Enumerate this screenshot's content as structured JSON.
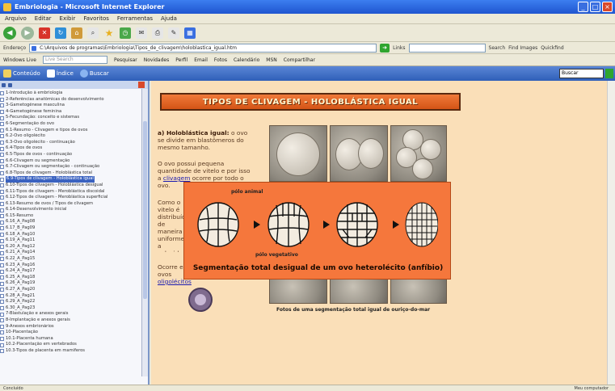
{
  "window": {
    "title": "Embriologia - Microsoft Internet Explorer"
  },
  "menu": [
    "Arquivo",
    "Editar",
    "Exibir",
    "Favoritos",
    "Ferramentas",
    "Ajuda"
  ],
  "address": {
    "label": "Endereço",
    "url": "C:\\Arquivos de programas\\Embriologia\\Tipos_de_clivagem\\holoblastica_igual.htm",
    "links_label": "Links"
  },
  "links_bar": {
    "items": [
      "Windows Live",
      "Pesquisar",
      "Novidades",
      "Perfil",
      "Email",
      "Fotos",
      "Calendário",
      "MSN",
      "Compartilhar"
    ],
    "search_placeholder": "Live Search",
    "right_items": [
      "Search",
      "Find Images",
      "Quickfind"
    ]
  },
  "help_bar": {
    "tabs": [
      "Conteúdo",
      "Índice",
      "Buscar"
    ],
    "find_value": "Buscar"
  },
  "sidebar": {
    "items": [
      {
        "label": "1-Introdução à embriologia",
        "sel": false
      },
      {
        "label": "2-Referências anatômicas do desenvolvimento",
        "sel": false
      },
      {
        "label": "3-Gametogênese masculina",
        "sel": false
      },
      {
        "label": "4-Gametogênese feminina",
        "sel": false
      },
      {
        "label": "5-Fecundação: conceito e sistemas",
        "sel": false
      },
      {
        "label": "6-Segmentação do ovo",
        "sel": false
      },
      {
        "label": "6.1-Resumo - Clivagem e tipos de ovos",
        "sel": false
      },
      {
        "label": "6.2-Ovo oligolécito",
        "sel": false
      },
      {
        "label": "6.3-Ovo oligolécito - continuação",
        "sel": false
      },
      {
        "label": "6.4-Tipos de ovos",
        "sel": false
      },
      {
        "label": "6.5-Tipos de ovos - continuação",
        "sel": false
      },
      {
        "label": "6.6-Clivagem ou segmentação",
        "sel": false
      },
      {
        "label": "6.7-Clivagem ou segmentação - continuação",
        "sel": false
      },
      {
        "label": "6.8-Tipos de clivagem - Holoblástica total",
        "sel": false
      },
      {
        "label": "6.9-Tipos de clivagem - Holoblástica igual",
        "sel": true
      },
      {
        "label": "6.10-Tipos de clivagem - Holoblástica desigual",
        "sel": false
      },
      {
        "label": "6.11-Tipos de clivagem - Meroblástica discoidal",
        "sel": false
      },
      {
        "label": "6.12-Tipos de clivagem - Meroblástica superficial",
        "sel": false
      },
      {
        "label": "6.13-Resumo de ovos / Tipos de clivagem",
        "sel": false
      },
      {
        "label": "6.14-Desenvolvimento inicial",
        "sel": false
      },
      {
        "label": "6.15-Resumo",
        "sel": false
      },
      {
        "label": "6.16_A_Pag08",
        "sel": false
      },
      {
        "label": "6.17_B_Pag09",
        "sel": false
      },
      {
        "label": "6.18_A_Pag10",
        "sel": false
      },
      {
        "label": "6.19_A_Pag11",
        "sel": false
      },
      {
        "label": "6.20_A_Pag12",
        "sel": false
      },
      {
        "label": "6.21_A_Pag14",
        "sel": false
      },
      {
        "label": "6.22_A_Pag15",
        "sel": false
      },
      {
        "label": "6.23_A_Pag16",
        "sel": false
      },
      {
        "label": "6.24_A_Pag17",
        "sel": false
      },
      {
        "label": "6.25_A_Pag18",
        "sel": false
      },
      {
        "label": "6.26_A_Pag19",
        "sel": false
      },
      {
        "label": "6.27_A_Pag20",
        "sel": false
      },
      {
        "label": "6.28_A_Pag21",
        "sel": false
      },
      {
        "label": "6.29_A_Pag22",
        "sel": false
      },
      {
        "label": "6.30_A_Pag23",
        "sel": false
      },
      {
        "label": "7-Blastulação e anexos gerais",
        "sel": false
      },
      {
        "label": "8-Implantação e anexos gerais",
        "sel": false
      },
      {
        "label": "9-Anexos embrionários",
        "sel": false
      },
      {
        "label": "10-Placentação",
        "sel": false
      },
      {
        "label": "10.1-Placenta humana",
        "sel": false
      },
      {
        "label": "10.2-Placentação em vertebrados",
        "sel": false
      },
      {
        "label": "10.3-Tipos de placenta em mamíferos",
        "sel": false
      }
    ]
  },
  "content": {
    "banner": "TIPOS DE CLIVAGEM - HOLOBLÁSTICA IGUAL",
    "p1_bold": "a) Holoblástica igual:",
    "p1_rest": " o ovo se divide em blastômeros do mesmo tamanho.",
    "p2_pre": "O ovo possui pequena quantidade de vitelo e por isso a ",
    "p2_link": "clivagem",
    "p2_post": " ocorre por todo o ovo.",
    "p3": "Como o vitelo é distribuído de maneira uniforme, a velocidade de divisão é a mesma em todo o ovo, formando blastômeros do mesmo tamanho (iguais).",
    "p4_pre": "Ocorre em ovos ",
    "p4_link": "oligolécitos",
    "photo_caption": "Fotos de uma segmentação total igual de ouriço-do-mar",
    "overlay": {
      "pole_top": "pólo animal",
      "pole_bottom": "pólo vegetativo",
      "caption": "Segmentação total desigual de um ovo heterolécito (anfíbio)"
    }
  },
  "status": {
    "text": "Concluído",
    "zone": "Meu computador"
  }
}
